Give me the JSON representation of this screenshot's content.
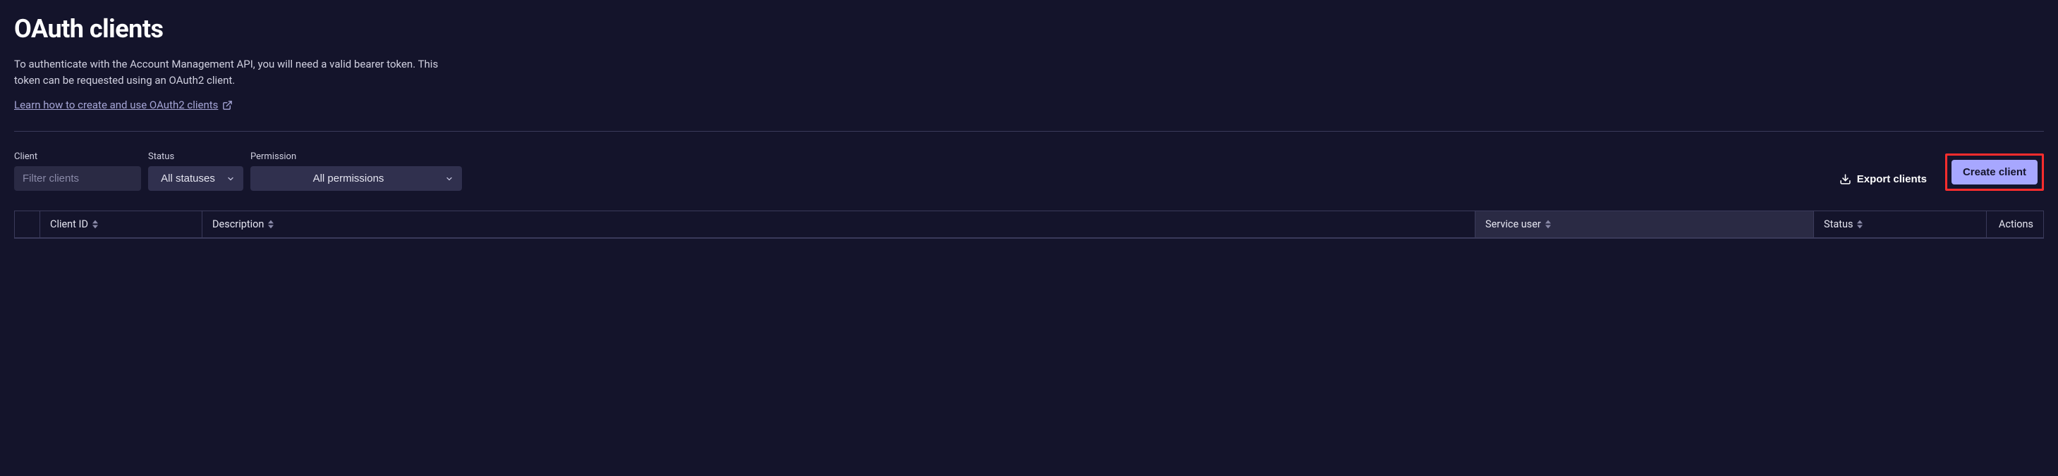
{
  "header": {
    "title": "OAuth clients",
    "description": "To authenticate with the Account Management API, you will need a valid bearer token. This token can be requested using an OAuth2 client.",
    "learn_link": "Learn how to create and use OAuth2 clients"
  },
  "filters": {
    "client": {
      "label": "Client",
      "placeholder": "Filter clients",
      "value": ""
    },
    "status": {
      "label": "Status",
      "selected": "All statuses"
    },
    "permission": {
      "label": "Permission",
      "selected": "All permissions"
    }
  },
  "actions": {
    "export_label": "Export clients",
    "create_label": "Create client"
  },
  "table": {
    "columns": {
      "client_id": "Client ID",
      "description": "Description",
      "service_user": "Service user",
      "status": "Status",
      "actions": "Actions"
    }
  }
}
